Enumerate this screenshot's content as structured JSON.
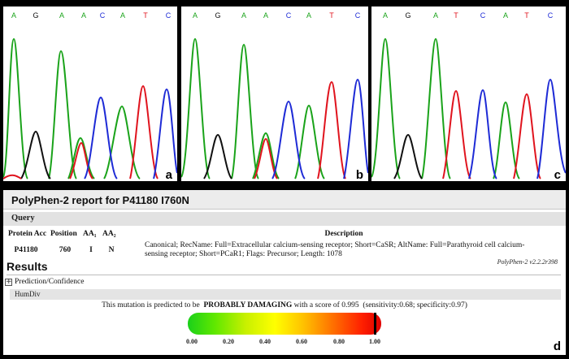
{
  "chromatograms": [
    {
      "label": "a",
      "bases": [
        "A",
        "G",
        "A",
        "A",
        "C",
        "A",
        "T",
        "C"
      ]
    },
    {
      "label": "b",
      "bases": [
        "A",
        "G",
        "A",
        "A",
        "C",
        "A",
        "T",
        "C"
      ]
    },
    {
      "label": "c",
      "bases": [
        "A",
        "G",
        "A",
        "T",
        "C",
        "A",
        "T",
        "C"
      ]
    }
  ],
  "base_colors": {
    "A": "#1aa31a",
    "G": "#111111",
    "T": "#e0141e",
    "C": "#1e2bd6"
  },
  "report": {
    "title": "PolyPhen-2 report for P41180 I760N",
    "query_label": "Query",
    "columns": {
      "protein_acc": "Protein Acc",
      "position": "Position",
      "aa1": "AA₁",
      "aa2": "AA₂",
      "description": "Description"
    },
    "row": {
      "protein_acc": "P41180",
      "position": "760",
      "aa1": "I",
      "aa2": "N",
      "description": "Canonical; RecName: Full=Extracellular calcium-sensing receptor; Short=CaSR; AltName: Full=Parathyroid cell calcium-sensing receptor; Short=PCaR1; Flags: Precursor; Length: 1078"
    },
    "version": "PolyPhen-2 v2.2.2r398",
    "results_title": "Results",
    "prediction_label": "Prediction/Confidence",
    "humdiv_label": "HumDiv",
    "verdict": {
      "prefix": "This mutation is predicted to be",
      "call": "PROBABLY DAMAGING",
      "score_text": "with a score of 0.995",
      "metrics": "(sensitivity:0.68; specificity:0.97)"
    },
    "score": 0.995,
    "scale_ticks": [
      "0.00",
      "0.20",
      "0.40",
      "0.60",
      "0.80",
      "1.00"
    ],
    "panel_label": "d"
  }
}
